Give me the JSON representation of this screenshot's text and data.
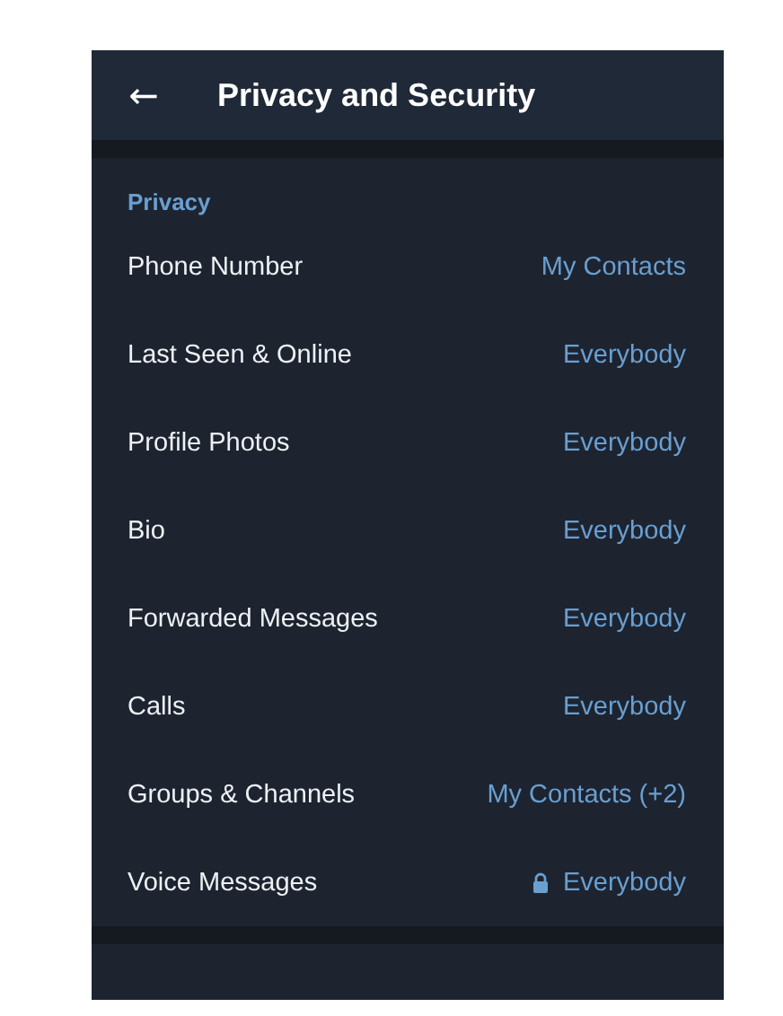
{
  "header": {
    "back": "←",
    "title": "Privacy and Security"
  },
  "section": {
    "title": "Privacy",
    "items": [
      {
        "label": "Phone Number",
        "value": "My Contacts",
        "locked": false
      },
      {
        "label": "Last Seen & Online",
        "value": "Everybody",
        "locked": false
      },
      {
        "label": "Profile Photos",
        "value": "Everybody",
        "locked": false
      },
      {
        "label": "Bio",
        "value": "Everybody",
        "locked": false
      },
      {
        "label": "Forwarded Messages",
        "value": "Everybody",
        "locked": false
      },
      {
        "label": "Calls",
        "value": "Everybody",
        "locked": false
      },
      {
        "label": "Groups & Channels",
        "value": "My Contacts (+2)",
        "locked": false
      },
      {
        "label": "Voice Messages",
        "value": "Everybody",
        "locked": true
      }
    ]
  }
}
